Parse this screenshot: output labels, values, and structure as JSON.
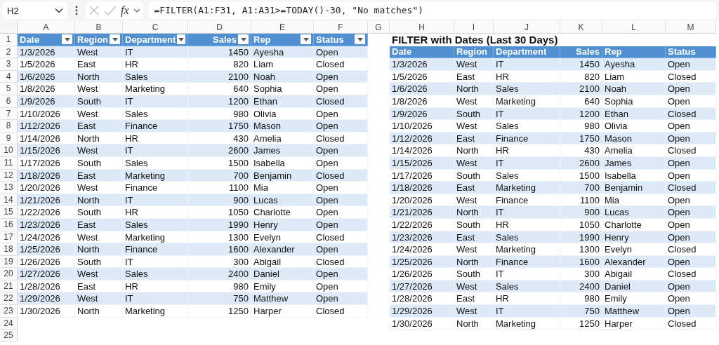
{
  "formula_bar": {
    "name_box": "H2",
    "function_label": "fx",
    "formula": "=FILTER(A1:F31, A1:A31>=TODAY()-30, \"No matches\")"
  },
  "column_headers": [
    "A",
    "B",
    "C",
    "D",
    "E",
    "F",
    "G",
    "H",
    "I",
    "J",
    "K",
    "L",
    "M"
  ],
  "row_numbers": [
    "1",
    "2",
    "3",
    "4",
    "5",
    "6",
    "7",
    "8",
    "9",
    "10",
    "11",
    "12",
    "13",
    "14",
    "15",
    "16",
    "17",
    "18",
    "19",
    "20",
    "21",
    "22",
    "23",
    "24",
    "25"
  ],
  "source_table": {
    "columns": [
      "Date",
      "Region",
      "Department",
      "Sales",
      "Rep",
      "Status"
    ],
    "rows": [
      [
        "1/3/2026",
        "West",
        "IT",
        "1450",
        "Ayesha",
        "Open"
      ],
      [
        "1/5/2026",
        "East",
        "HR",
        "820",
        "Liam",
        "Closed"
      ],
      [
        "1/6/2026",
        "North",
        "Sales",
        "2100",
        "Noah",
        "Open"
      ],
      [
        "1/8/2026",
        "West",
        "Marketing",
        "640",
        "Sophia",
        "Open"
      ],
      [
        "1/9/2026",
        "South",
        "IT",
        "1200",
        "Ethan",
        "Closed"
      ],
      [
        "1/10/2026",
        "West",
        "Sales",
        "980",
        "Olivia",
        "Open"
      ],
      [
        "1/12/2026",
        "East",
        "Finance",
        "1750",
        "Mason",
        "Open"
      ],
      [
        "1/14/2026",
        "North",
        "HR",
        "430",
        "Amelia",
        "Closed"
      ],
      [
        "1/15/2026",
        "West",
        "IT",
        "2600",
        "James",
        "Open"
      ],
      [
        "1/17/2026",
        "South",
        "Sales",
        "1500",
        "Isabella",
        "Open"
      ],
      [
        "1/18/2026",
        "East",
        "Marketing",
        "700",
        "Benjamin",
        "Closed"
      ],
      [
        "1/20/2026",
        "West",
        "Finance",
        "1100",
        "Mia",
        "Open"
      ],
      [
        "1/21/2026",
        "North",
        "IT",
        "900",
        "Lucas",
        "Open"
      ],
      [
        "1/22/2026",
        "South",
        "HR",
        "1050",
        "Charlotte",
        "Open"
      ],
      [
        "1/23/2026",
        "East",
        "Sales",
        "1990",
        "Henry",
        "Open"
      ],
      [
        "1/24/2026",
        "West",
        "Marketing",
        "1300",
        "Evelyn",
        "Closed"
      ],
      [
        "1/25/2026",
        "North",
        "Finance",
        "1600",
        "Alexander",
        "Open"
      ],
      [
        "1/26/2026",
        "South",
        "IT",
        "300",
        "Abigail",
        "Closed"
      ],
      [
        "1/27/2026",
        "West",
        "Sales",
        "2400",
        "Daniel",
        "Open"
      ],
      [
        "1/28/2026",
        "East",
        "HR",
        "980",
        "Emily",
        "Open"
      ],
      [
        "1/29/2026",
        "West",
        "IT",
        "750",
        "Matthew",
        "Open"
      ],
      [
        "1/30/2026",
        "North",
        "Marketing",
        "1250",
        "Harper",
        "Closed"
      ]
    ]
  },
  "filtered_table": {
    "title": "FILTER with Dates (Last 30 Days)",
    "columns": [
      "Date",
      "Region",
      "Department",
      "Sales",
      "Rep",
      "Status"
    ],
    "rows": [
      [
        "1/3/2026",
        "West",
        "IT",
        "1450",
        "Ayesha",
        "Open"
      ],
      [
        "1/5/2026",
        "East",
        "HR",
        "820",
        "Liam",
        "Closed"
      ],
      [
        "1/6/2026",
        "North",
        "Sales",
        "2100",
        "Noah",
        "Open"
      ],
      [
        "1/8/2026",
        "West",
        "Marketing",
        "640",
        "Sophia",
        "Open"
      ],
      [
        "1/9/2026",
        "South",
        "IT",
        "1200",
        "Ethan",
        "Closed"
      ],
      [
        "1/10/2026",
        "West",
        "Sales",
        "980",
        "Olivia",
        "Open"
      ],
      [
        "1/12/2026",
        "East",
        "Finance",
        "1750",
        "Mason",
        "Open"
      ],
      [
        "1/14/2026",
        "North",
        "HR",
        "430",
        "Amelia",
        "Closed"
      ],
      [
        "1/15/2026",
        "West",
        "IT",
        "2600",
        "James",
        "Open"
      ],
      [
        "1/17/2026",
        "South",
        "Sales",
        "1500",
        "Isabella",
        "Open"
      ],
      [
        "1/18/2026",
        "East",
        "Marketing",
        "700",
        "Benjamin",
        "Closed"
      ],
      [
        "1/20/2026",
        "West",
        "Finance",
        "1100",
        "Mia",
        "Open"
      ],
      [
        "1/21/2026",
        "North",
        "IT",
        "900",
        "Lucas",
        "Open"
      ],
      [
        "1/22/2026",
        "South",
        "HR",
        "1050",
        "Charlotte",
        "Open"
      ],
      [
        "1/23/2026",
        "East",
        "Sales",
        "1990",
        "Henry",
        "Open"
      ],
      [
        "1/24/2026",
        "West",
        "Marketing",
        "1300",
        "Evelyn",
        "Closed"
      ],
      [
        "1/25/2026",
        "North",
        "Finance",
        "1600",
        "Alexander",
        "Open"
      ],
      [
        "1/26/2026",
        "South",
        "IT",
        "300",
        "Abigail",
        "Closed"
      ],
      [
        "1/27/2026",
        "West",
        "Sales",
        "2400",
        "Daniel",
        "Open"
      ],
      [
        "1/28/2026",
        "East",
        "HR",
        "980",
        "Emily",
        "Open"
      ],
      [
        "1/29/2026",
        "West",
        "IT",
        "750",
        "Matthew",
        "Open"
      ],
      [
        "1/30/2026",
        "North",
        "Marketing",
        "1250",
        "Harper",
        "Closed"
      ]
    ]
  }
}
